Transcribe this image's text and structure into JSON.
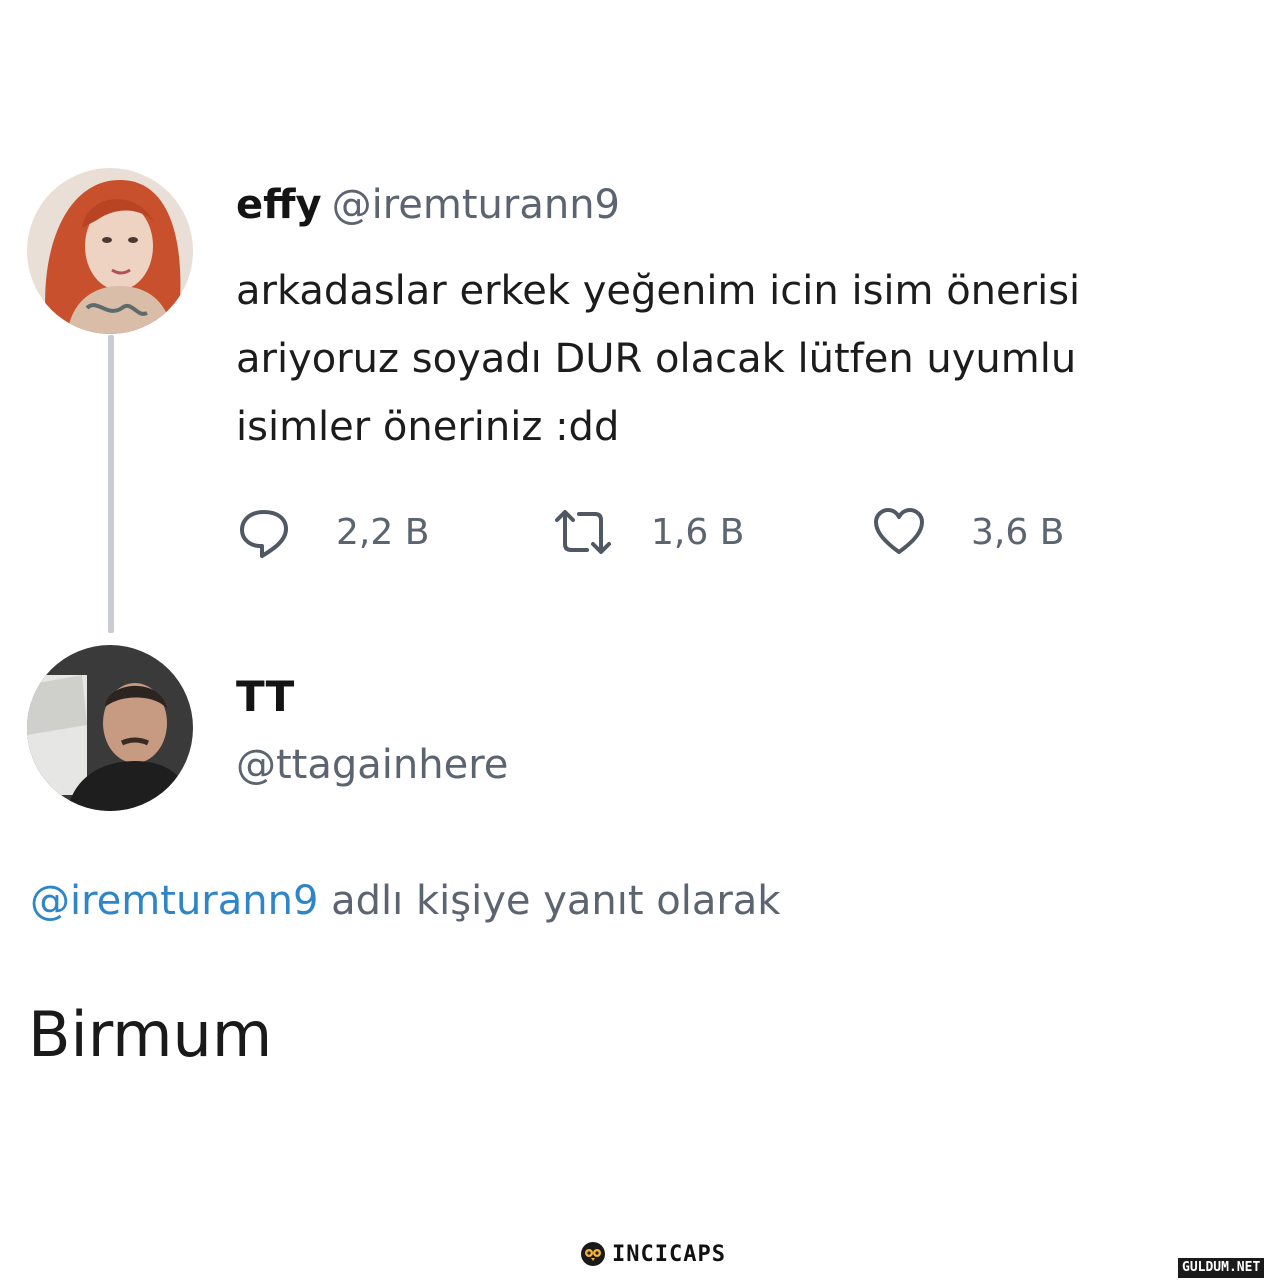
{
  "tweet": {
    "author_name": "effy",
    "author_handle": "@iremturann9",
    "body_lines": [
      "arkadaslar erkek yeğenim icin isim önerisi",
      "ariyoruz soyadı DUR olacak lütfen uyumlu",
      "isimler öneriniz :dd"
    ],
    "actions": {
      "reply_icon": "comment-icon",
      "reply_count": "2,2 B",
      "retweet_icon": "retweet-icon",
      "retweet_count": "1,6 B",
      "like_icon": "heart-icon",
      "like_count": "3,6 B"
    }
  },
  "reply": {
    "author_name": "TT",
    "author_handle": "@ttagainhere",
    "reply_to_mention": "@iremturann9",
    "reply_to_text": " adlı kişiye yanıt olarak",
    "body": "Birmum"
  },
  "footer": {
    "brand_icon": "owl-icon",
    "brand_name": "INCICAPS",
    "watermark": "GULDUM.NET"
  },
  "colors": {
    "text": "#141414",
    "secondary": "#5b6470",
    "mention": "#2e85c8",
    "thread_line": "#c9cdd1"
  }
}
